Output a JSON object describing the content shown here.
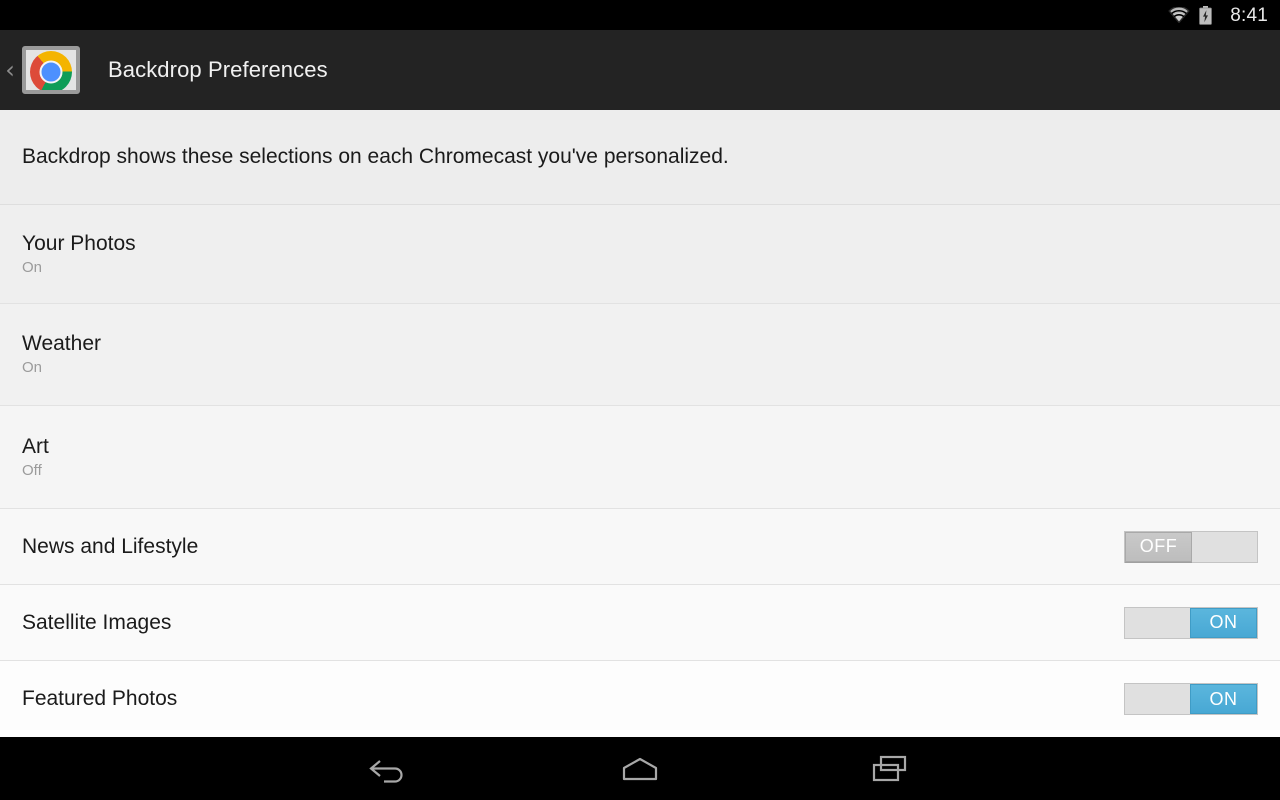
{
  "status_bar": {
    "time": "8:41",
    "wifi_icon": "wifi-icon",
    "battery_icon": "battery-charging-icon"
  },
  "action_bar": {
    "back_icon": "back-chevron-icon",
    "app_icon": "chromecast-app-icon",
    "title": "Backdrop Preferences"
  },
  "main": {
    "info_text": "Backdrop shows these selections on each Chromecast you've personalized.",
    "rows": [
      {
        "title": "Your Photos",
        "subtitle": "On",
        "control": "none"
      },
      {
        "title": "Weather",
        "subtitle": "On",
        "control": "none"
      },
      {
        "title": "Art",
        "subtitle": "Off",
        "control": "none"
      },
      {
        "title": "News and Lifestyle",
        "subtitle": "",
        "control": "switch",
        "switch_state": "off",
        "switch_label": "OFF"
      },
      {
        "title": "Satellite Images",
        "subtitle": "",
        "control": "switch",
        "switch_state": "on",
        "switch_label": "ON"
      },
      {
        "title": "Featured Photos",
        "subtitle": "",
        "control": "switch",
        "switch_state": "on",
        "switch_label": "ON"
      }
    ]
  },
  "nav_bar": {
    "back_label": "back-icon",
    "home_label": "home-icon",
    "recents_label": "recents-icon"
  },
  "colors": {
    "status_bar_bg": "#000000",
    "action_bar_bg": "#232323",
    "switch_on": "#4fafd8",
    "switch_off": "#c3c3c3",
    "text_primary": "#1b1b1b",
    "text_secondary": "#9b9b9b"
  }
}
